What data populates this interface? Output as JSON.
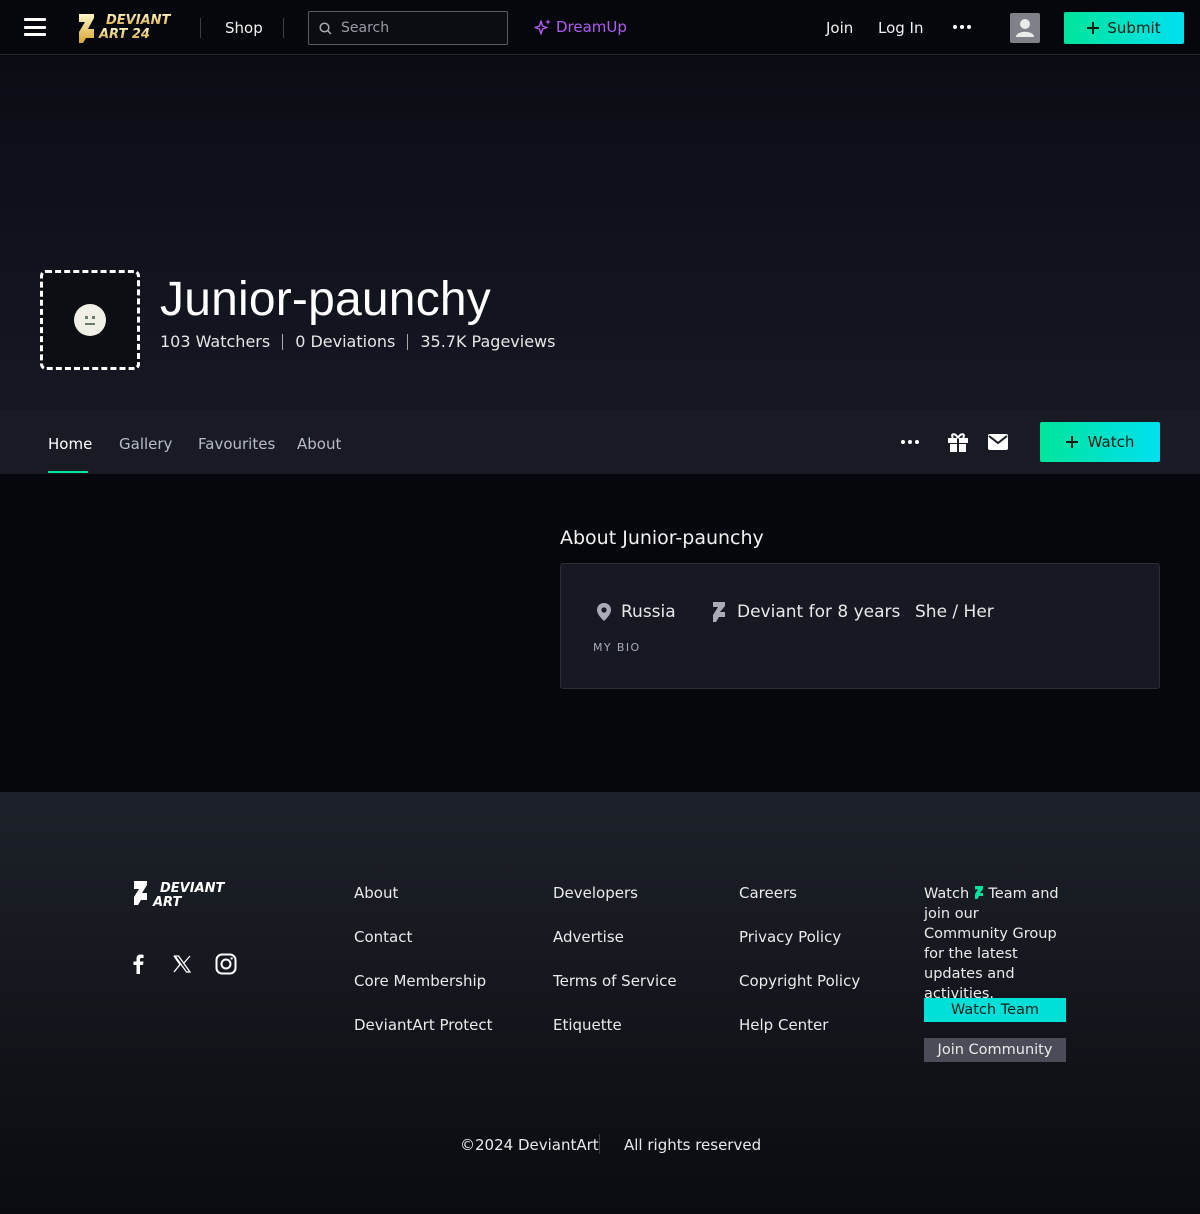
{
  "top_nav": {
    "logo_text": [
      "DEVIANT",
      "ART 24"
    ],
    "shop": "Shop",
    "search_placeholder": "Search",
    "dreamup": "DreamUp",
    "join": "Join",
    "login": "Log In",
    "submit": "Submit"
  },
  "profile": {
    "username": "Junior-paunchy",
    "watchers": "103 Watchers",
    "deviations": "0 Deviations",
    "pageviews": "35.7K Pageviews"
  },
  "tabs": [
    "Home",
    "Gallery",
    "Favourites",
    "About"
  ],
  "active_tab": "Home",
  "watch_button": "Watch",
  "about": {
    "heading": "About Junior-paunchy",
    "location": "Russia",
    "membership": "Deviant for 8 years",
    "pronouns": "She / Her",
    "bio_label": "MY BIO"
  },
  "footer": {
    "logo_text": [
      "DEVIANT",
      "ART"
    ],
    "col1": [
      "About",
      "Contact",
      "Core Membership",
      "DeviantArt Protect"
    ],
    "col2": [
      "Developers",
      "Advertise",
      "Terms of Service",
      "Etiquette"
    ],
    "col3": [
      "Careers",
      "Privacy Policy",
      "Copyright Policy",
      "Help Center"
    ],
    "watch_text_prefix": "Watch",
    "watch_text_suffix": "Team and join our Community Group for the latest updates and activities.",
    "watch_team": "Watch Team",
    "join_community": "Join Community",
    "copyright": "©2024 DeviantArt",
    "rights": "All rights reserved"
  },
  "colors": {
    "accent_green": "#00e59b",
    "accent_cyan": "#00e0f0",
    "dreamup_purple": "#b05bf0",
    "background": "#06070d"
  },
  "icons": [
    "menu-icon",
    "search-icon",
    "sparkle-icon",
    "more-dots-icon",
    "user-icon",
    "plus-icon",
    "gift-icon",
    "mail-icon",
    "location-pin-icon",
    "deviantart-logo-icon",
    "facebook-icon",
    "x-icon",
    "instagram-icon"
  ]
}
